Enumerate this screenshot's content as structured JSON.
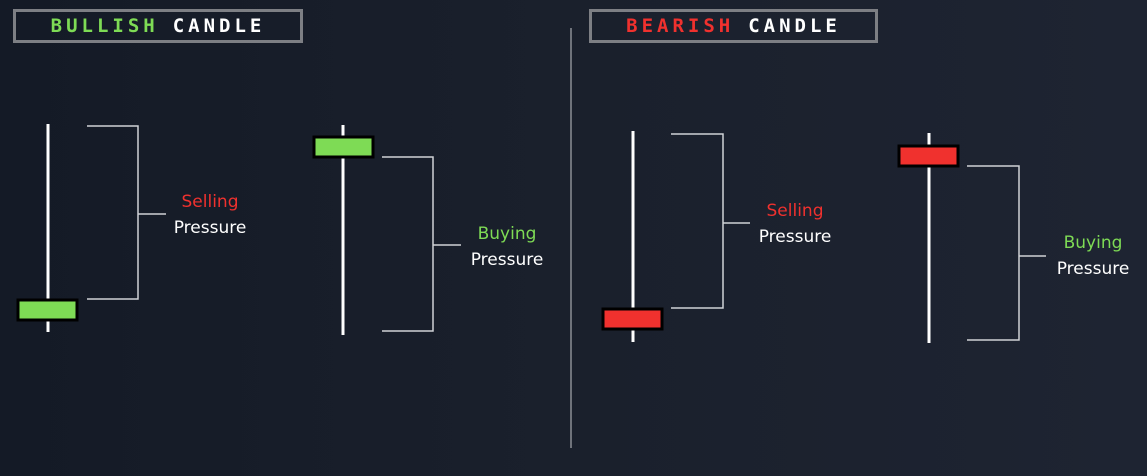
{
  "bullish_title": {
    "word1": "BULLISH",
    "word2": "CANDLE"
  },
  "bearish_title": {
    "word1": "BEARISH",
    "word2": "CANDLE"
  },
  "bull_left_label": {
    "line1": "Selling",
    "line2": "Pressure"
  },
  "bull_right_label": {
    "line1": "Buying",
    "line2": "Pressure"
  },
  "bear_left_label": {
    "line1": "Selling",
    "line2": "Pressure"
  },
  "bear_right_label": {
    "line1": "Buying",
    "line2": "Pressure"
  },
  "colors": {
    "bullish": "#7edb55",
    "bearish": "#f0312e",
    "wick": "#ffffff",
    "bracket": "#d0d2d6",
    "background": "#1a202c"
  }
}
